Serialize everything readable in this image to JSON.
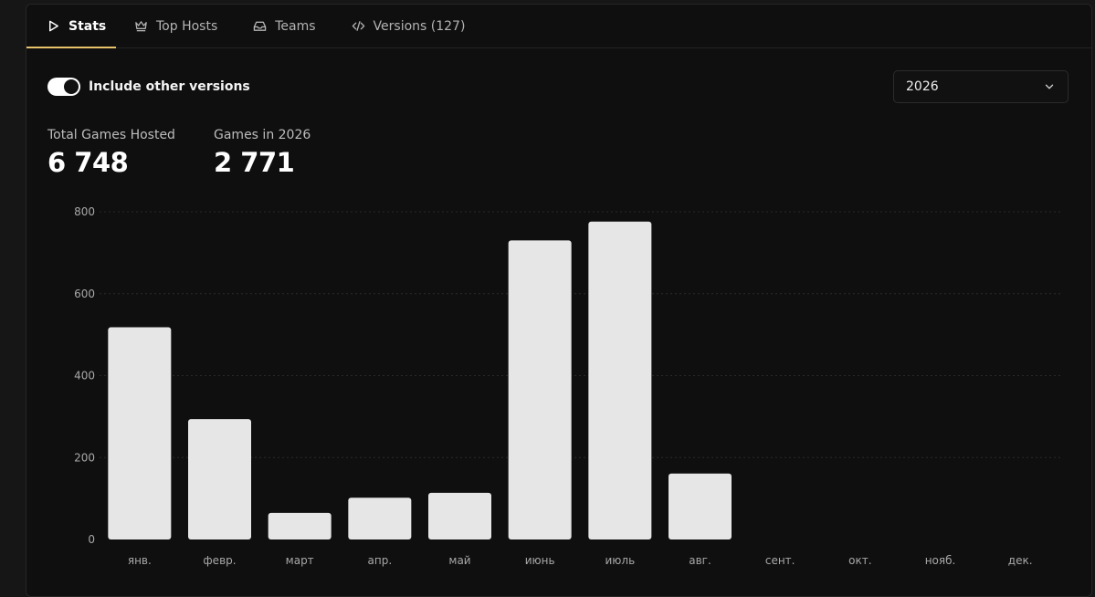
{
  "tabs": [
    {
      "label": "Stats",
      "icon": "play-icon",
      "active": true
    },
    {
      "label": "Top Hosts",
      "icon": "crown-icon",
      "active": false
    },
    {
      "label": "Teams",
      "icon": "inbox-icon",
      "active": false
    },
    {
      "label": "Versions (127)",
      "icon": "code-icon",
      "active": false
    }
  ],
  "toggle": {
    "label": "Include other versions",
    "checked": true
  },
  "year_select": {
    "value": "2026"
  },
  "stats": {
    "total_label": "Total Games Hosted",
    "total_value": "6 748",
    "year_label": "Games in 2026",
    "year_value": "2 771"
  },
  "colors": {
    "accent": "#e8c36a",
    "bar": "#e6e6e6",
    "background": "#0f0f0f"
  },
  "chart_data": {
    "type": "bar",
    "categories": [
      "янв.",
      "февр.",
      "март",
      "апр.",
      "май",
      "июнь",
      "июль",
      "авг.",
      "сент.",
      "окт.",
      "нояб.",
      "дек."
    ],
    "values": [
      518,
      294,
      65,
      102,
      114,
      730,
      776,
      161,
      0,
      0,
      0,
      0
    ],
    "yticks": [
      "0",
      "200",
      "400",
      "600",
      "800"
    ],
    "ylim": [
      0,
      800
    ],
    "grid": true,
    "title": "",
    "xlabel": "",
    "ylabel": ""
  }
}
